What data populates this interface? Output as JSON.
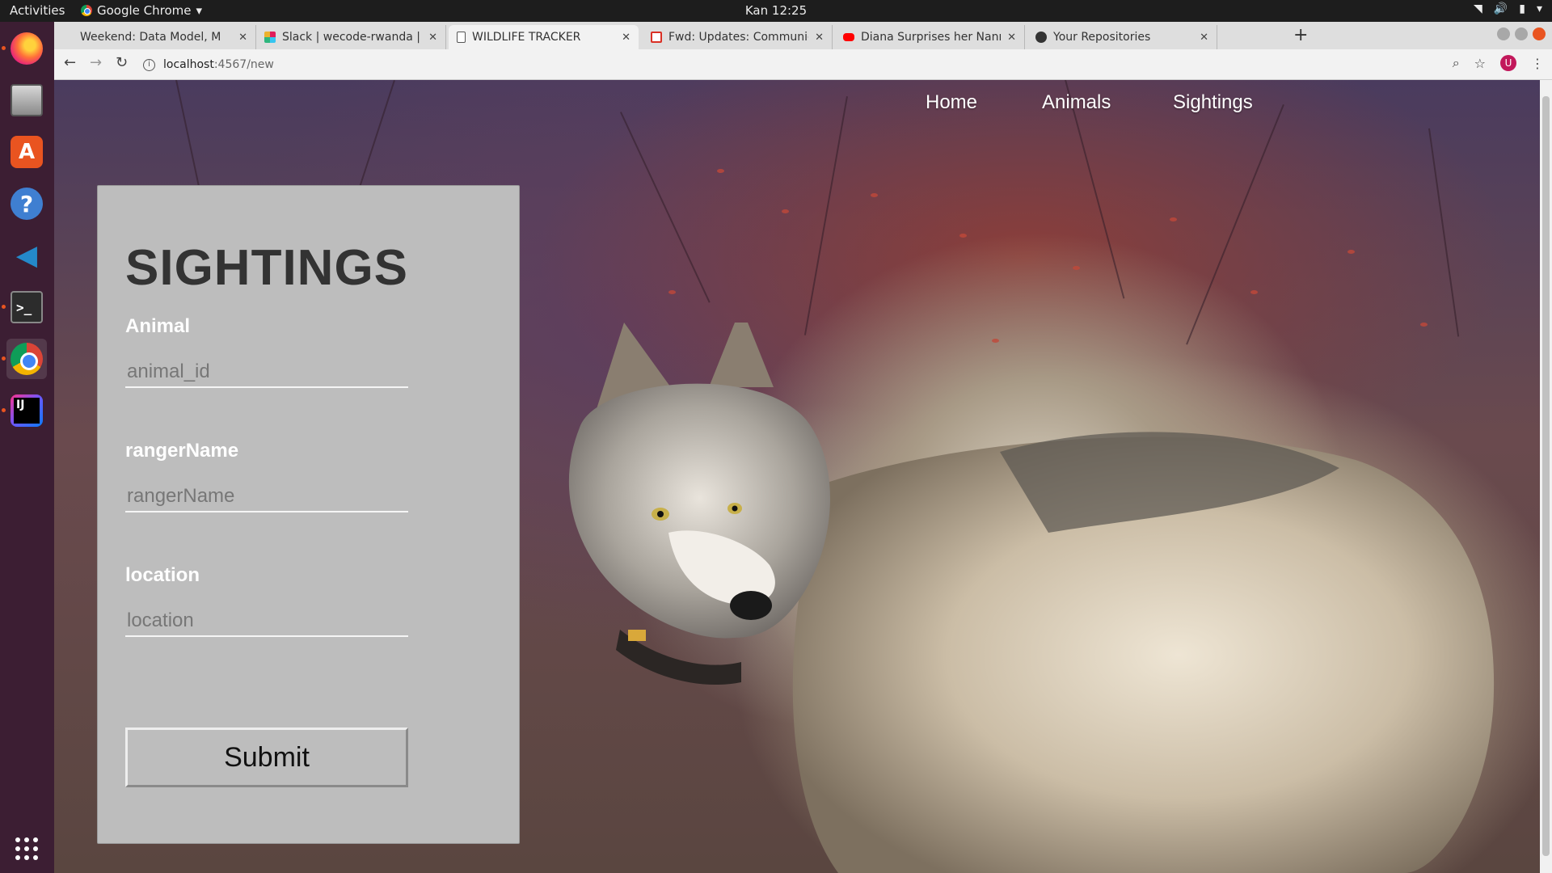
{
  "topbar": {
    "activities": "Activities",
    "app_name": "Google Chrome",
    "clock": "Kan 12:25"
  },
  "dock": [
    "firefox-icon",
    "files-icon",
    "software-center-icon",
    "help-icon",
    "vscode-icon",
    "terminal-icon",
    "chrome-icon",
    "intellij-icon",
    "show-apps-icon"
  ],
  "browser": {
    "tabs": [
      {
        "title": "Weekend: Data Model, M",
        "icon": "generic-icon"
      },
      {
        "title": "Slack | wecode-rwanda | M",
        "icon": "slack-icon"
      },
      {
        "title": "WILDLIFE TRACKER",
        "icon": "document-icon",
        "active": true
      },
      {
        "title": "Fwd: Updates: Communic",
        "icon": "gmail-icon"
      },
      {
        "title": "Diana Surprises her Nann",
        "icon": "youtube-icon"
      },
      {
        "title": "Your Repositories",
        "icon": "github-icon"
      }
    ],
    "url_host": "localhost",
    "url_path": ":4567/new",
    "profile_initial": "U"
  },
  "site": {
    "nav": {
      "home": "Home",
      "animals": "Animals",
      "sightings": "Sightings"
    },
    "form": {
      "title": "SIGHTINGS",
      "animal_label": "Animal",
      "animal_placeholder": "animal_id",
      "ranger_label": "rangerName",
      "ranger_placeholder": "rangerName",
      "location_label": "location",
      "location_placeholder": "location",
      "submit": "Submit"
    }
  },
  "colors": {
    "form_bg": "#bdbdbd",
    "dock_bg": "#3c1e33",
    "ubuntu_orange": "#e95420"
  }
}
